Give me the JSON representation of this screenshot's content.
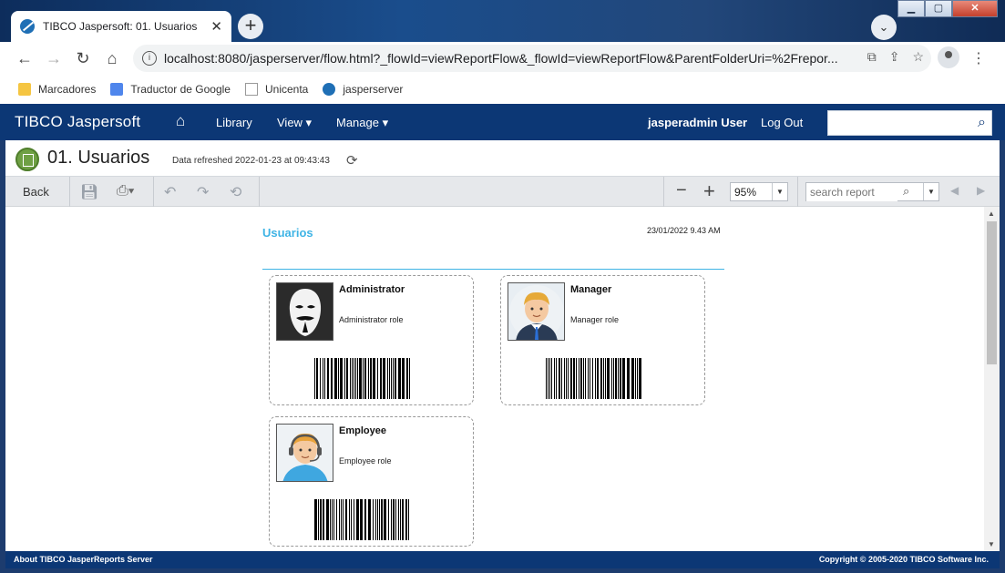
{
  "browser": {
    "tab_title": "TIBCO Jaspersoft: 01. Usuarios",
    "tab_close": "✕",
    "new_tab": "+",
    "url": "localhost:8080/jasperserver/flow.html?_flowId=viewReportFlow&_flowId=viewReportFlow&ParentFolderUri=%2Frepor...",
    "bookmarks": [
      {
        "label": "Marcadores",
        "icon": "folder-icon"
      },
      {
        "label": "Traductor de Google",
        "icon": "google-translate-icon"
      },
      {
        "label": "Unicenta",
        "icon": "document-icon"
      },
      {
        "label": "jasperserver",
        "icon": "jaspersoft-icon"
      }
    ]
  },
  "header": {
    "brand": "TIBCO Jaspersoft",
    "menu": [
      "Library",
      "View ▾",
      "Manage ▾"
    ],
    "user": "jasperadmin User",
    "logout": "Log Out",
    "search_placeholder": ""
  },
  "report_header": {
    "title": "01. Usuarios",
    "refreshed": "Data refreshed 2022-01-23 at 09:43:43"
  },
  "report_toolbar": {
    "back": "Back",
    "zoom": "95%",
    "search_placeholder": "search report"
  },
  "report": {
    "heading": "Usuarios",
    "date": "23/01/2022 9.43 AM",
    "cards": [
      {
        "name": "Administrator",
        "role": "Administrator role"
      },
      {
        "name": "Manager",
        "role": "Manager role"
      },
      {
        "name": "Employee",
        "role": "Employee role"
      }
    ]
  },
  "footer": {
    "left": "About TIBCO JasperReports Server",
    "right": "Copyright © 2005-2020 TIBCO Software Inc."
  },
  "colors": {
    "header_bg": "#0c3775",
    "accent": "#3fb4e5",
    "report_icon": "#6fa044"
  }
}
